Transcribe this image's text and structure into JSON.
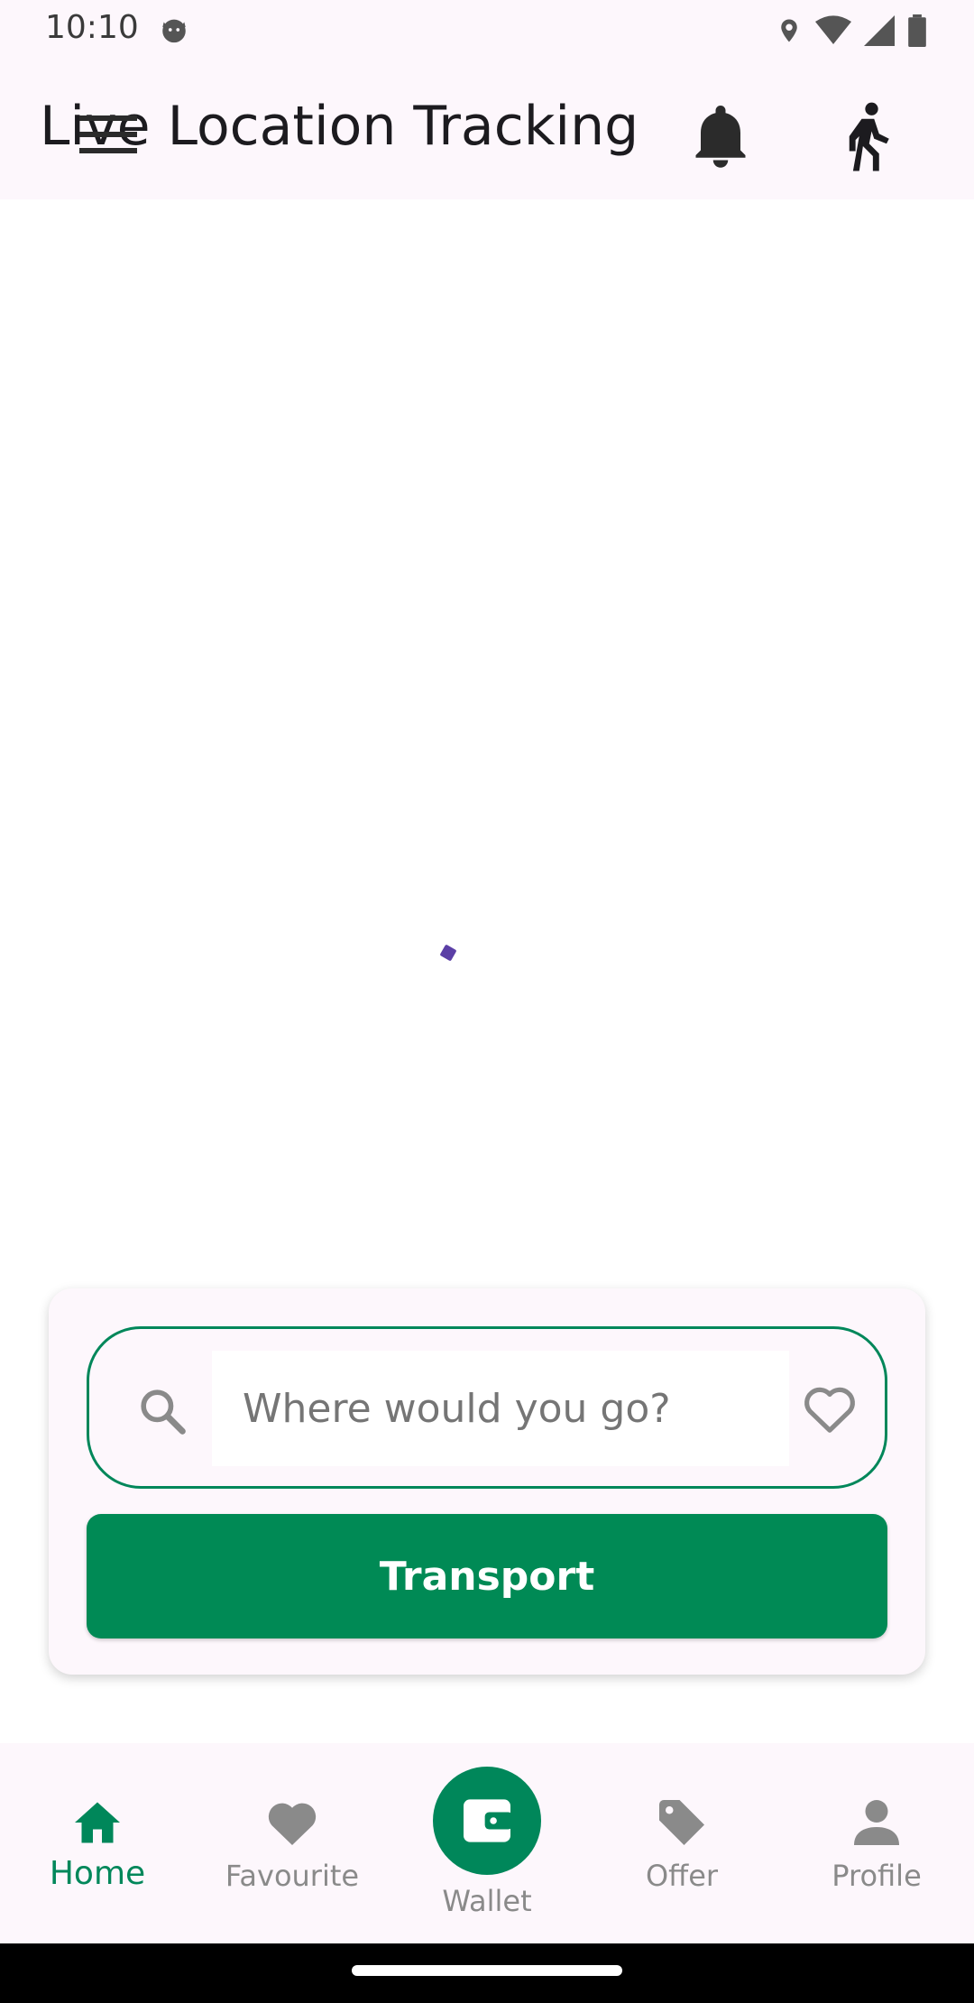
{
  "status_bar": {
    "time": "10:10",
    "icons": [
      "cat-face-icon",
      "location-pin-icon",
      "wifi-icon",
      "signal-icon",
      "battery-icon"
    ]
  },
  "app_bar": {
    "title": "Live Location Tracking",
    "icons": [
      "menu-icon",
      "bell-icon",
      "walking-person-icon"
    ]
  },
  "search": {
    "placeholder": "Where would you go?",
    "value": ""
  },
  "transport_button": {
    "label": "Transport"
  },
  "bottom_nav": {
    "items": [
      {
        "label": "Home",
        "icon": "home-icon",
        "active": true
      },
      {
        "label": "Favourite",
        "icon": "heart-icon",
        "active": false
      },
      {
        "label": "Wallet",
        "icon": "wallet-icon",
        "active": false
      },
      {
        "label": "Offer",
        "icon": "tag-icon",
        "active": false
      },
      {
        "label": "Profile",
        "icon": "person-icon",
        "active": false
      }
    ]
  },
  "colors": {
    "accent": "#00875a",
    "surface": "#fdf7fc",
    "inactive": "#8a8a8a",
    "loading_indicator": "#5b3fa6"
  }
}
